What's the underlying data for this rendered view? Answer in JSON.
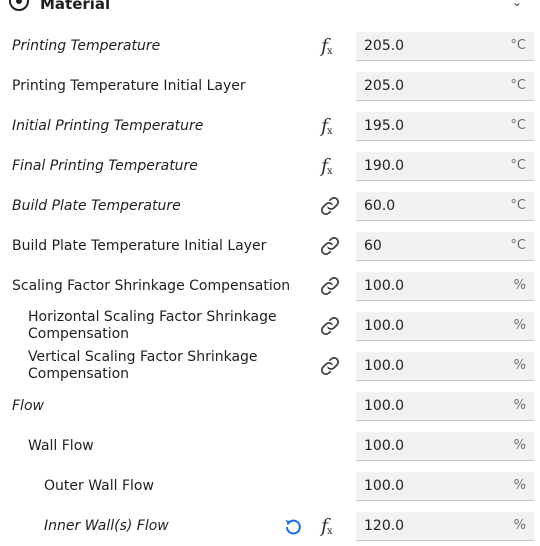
{
  "header": {
    "title": "Material",
    "icon": "material-category-icon",
    "collapse_icon": "chevron-down-icon"
  },
  "settings": [
    {
      "label": "Printing Temperature",
      "value": "205.0",
      "unit": "°C",
      "italic": true,
      "indicator": "fx"
    },
    {
      "label": "Printing Temperature Initial Layer",
      "value": "205.0",
      "unit": "°C",
      "italic": false,
      "indicator": "none"
    },
    {
      "label": "Initial Printing Temperature",
      "value": "195.0",
      "unit": "°C",
      "italic": true,
      "indicator": "fx"
    },
    {
      "label": "Final Printing Temperature",
      "value": "190.0",
      "unit": "°C",
      "italic": true,
      "indicator": "fx"
    },
    {
      "label": "Build Plate Temperature",
      "value": "60.0",
      "unit": "°C",
      "italic": true,
      "indicator": "link"
    },
    {
      "label": "Build Plate Temperature Initial Layer",
      "value": "60",
      "unit": "°C",
      "italic": false,
      "indicator": "link"
    },
    {
      "label": "Scaling Factor Shrinkage Compensation",
      "value": "100.0",
      "unit": "%",
      "italic": false,
      "indicator": "link"
    },
    {
      "label": "Horizontal Scaling Factor Shrinkage Compensation",
      "value": "100.0",
      "unit": "%",
      "italic": false,
      "indicator": "link"
    },
    {
      "label": "Vertical Scaling Factor Shrinkage Compensation",
      "value": "100.0",
      "unit": "%",
      "italic": false,
      "indicator": "link"
    },
    {
      "label": "Flow",
      "value": "100.0",
      "unit": "%",
      "italic": true,
      "indicator": "none"
    },
    {
      "label": "Wall Flow",
      "value": "100.0",
      "unit": "%",
      "italic": false,
      "indicator": "none"
    },
    {
      "label": "Outer Wall Flow",
      "value": "100.0",
      "unit": "%",
      "italic": false,
      "indicator": "none"
    },
    {
      "label": "Inner Wall(s) Flow",
      "value": "120.0",
      "unit": "%",
      "italic": true,
      "indicator": "fx",
      "reset": true
    }
  ]
}
